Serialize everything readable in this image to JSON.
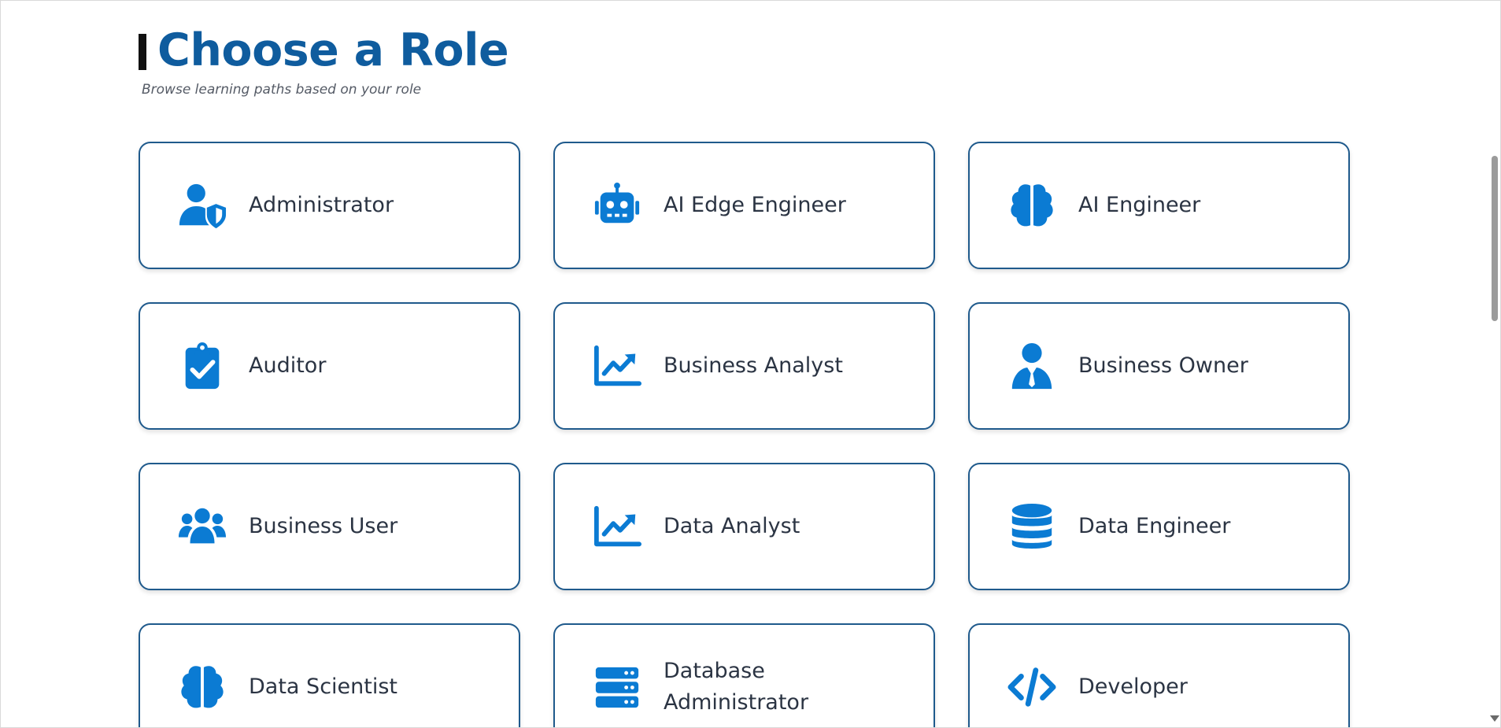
{
  "header": {
    "title": "Choose a Role",
    "subtitle": "Browse learning paths based on your role"
  },
  "colors": {
    "accent": "#0f5c9e",
    "icon": "#0b7bd3",
    "card_border": "#1f5a8c",
    "label": "#2b3443"
  },
  "roles": [
    {
      "label": "Administrator",
      "icon": "user-shield-icon"
    },
    {
      "label": "AI Edge Engineer",
      "icon": "robot-icon"
    },
    {
      "label": "AI Engineer",
      "icon": "brain-icon"
    },
    {
      "label": "Auditor",
      "icon": "clipboard-check-icon"
    },
    {
      "label": "Business Analyst",
      "icon": "chart-line-icon"
    },
    {
      "label": "Business Owner",
      "icon": "user-tie-icon"
    },
    {
      "label": "Business User",
      "icon": "users-icon"
    },
    {
      "label": "Data Analyst",
      "icon": "chart-line-icon"
    },
    {
      "label": "Data Engineer",
      "icon": "database-icon"
    },
    {
      "label": "Data Scientist",
      "icon": "brain-icon"
    },
    {
      "label": "Database Administrator",
      "icon": "server-icon"
    },
    {
      "label": "Developer",
      "icon": "code-icon"
    }
  ]
}
